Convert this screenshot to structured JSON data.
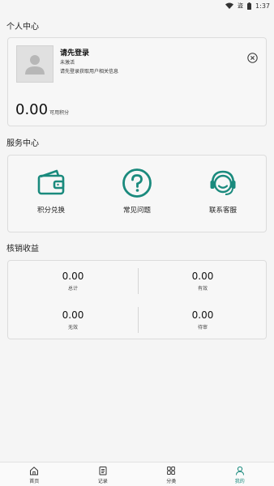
{
  "status_bar": {
    "time": "1:37",
    "extra_indicator": "盗"
  },
  "sections": {
    "personal_center": "个人中心",
    "service_center": "服务中心",
    "earnings": "核销收益"
  },
  "profile": {
    "login_title": "请先登录",
    "status": "未激活",
    "tip": "请先登录获取用户相关信息",
    "points_value": "0.00",
    "points_label": "可用积分"
  },
  "services": [
    {
      "label": "积分兑换",
      "icon": "wallet-icon"
    },
    {
      "label": "常见问题",
      "icon": "question-icon"
    },
    {
      "label": "联系客服",
      "icon": "customer-service-icon"
    }
  ],
  "earnings": [
    {
      "value": "0.00",
      "label": "总计"
    },
    {
      "value": "0.00",
      "label": "有效"
    },
    {
      "value": "0.00",
      "label": "无效"
    },
    {
      "value": "0.00",
      "label": "待审"
    }
  ],
  "tabs": [
    {
      "label": "首页",
      "icon": "home-icon"
    },
    {
      "label": "记录",
      "icon": "record-icon"
    },
    {
      "label": "分类",
      "icon": "category-icon"
    },
    {
      "label": "我的",
      "icon": "profile-icon",
      "active": true
    }
  ],
  "colors": {
    "accent": "#1a8a7d",
    "background": "#f5f5f5"
  }
}
